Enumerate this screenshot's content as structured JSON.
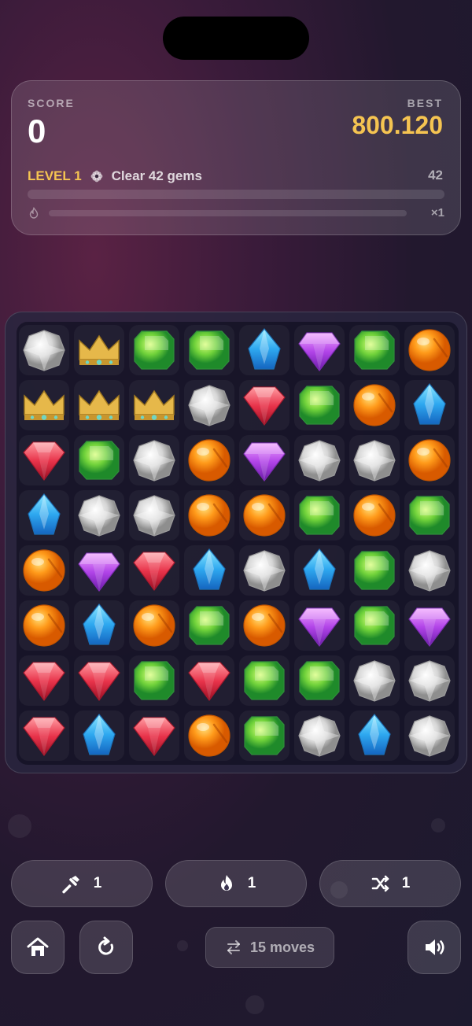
{
  "header": {
    "score_label": "SCORE",
    "score_value": "0",
    "best_label": "BEST",
    "best_value": "800.120"
  },
  "level": {
    "label": "LEVEL 1",
    "goal_icon": "flower-icon",
    "goal_text": "Clear 42 gems",
    "goal_count": "42",
    "progress": 0
  },
  "combo": {
    "icon": "flame-icon",
    "progress": 0,
    "multiplier": "×1"
  },
  "board": {
    "rows": 8,
    "cols": 8,
    "grid": [
      [
        "diamond",
        "crown",
        "green",
        "green",
        "blue",
        "purple",
        "green",
        "orange"
      ],
      [
        "crown",
        "crown",
        "crown",
        "diamond",
        "red",
        "green",
        "orange",
        "blue"
      ],
      [
        "red",
        "green",
        "diamond",
        "orange",
        "purple",
        "diamond",
        "diamond",
        "orange"
      ],
      [
        "blue",
        "diamond",
        "diamond",
        "orange",
        "orange",
        "green",
        "orange",
        "green"
      ],
      [
        "orange",
        "purple",
        "red",
        "blue",
        "diamond",
        "blue",
        "green",
        "diamond"
      ],
      [
        "orange",
        "blue",
        "orange",
        "green",
        "orange",
        "purple",
        "green",
        "purple"
      ],
      [
        "red",
        "red",
        "green",
        "red",
        "green",
        "green",
        "diamond",
        "diamond"
      ],
      [
        "red",
        "blue",
        "red",
        "orange",
        "green",
        "diamond",
        "blue",
        "diamond"
      ]
    ]
  },
  "boosters": [
    {
      "name": "hammer",
      "icon": "hammer-icon",
      "count": "1"
    },
    {
      "name": "bomb",
      "icon": "flame-icon",
      "count": "1"
    },
    {
      "name": "shuffle",
      "icon": "shuffle-icon",
      "count": "1"
    }
  ],
  "controls": {
    "home_icon": "home-icon",
    "restart_icon": "restart-icon",
    "moves_icon": "swap-icon",
    "moves_label": "15 moves",
    "sound_icon": "speaker-icon"
  },
  "colors": {
    "accent_gold": "#f5c451"
  }
}
